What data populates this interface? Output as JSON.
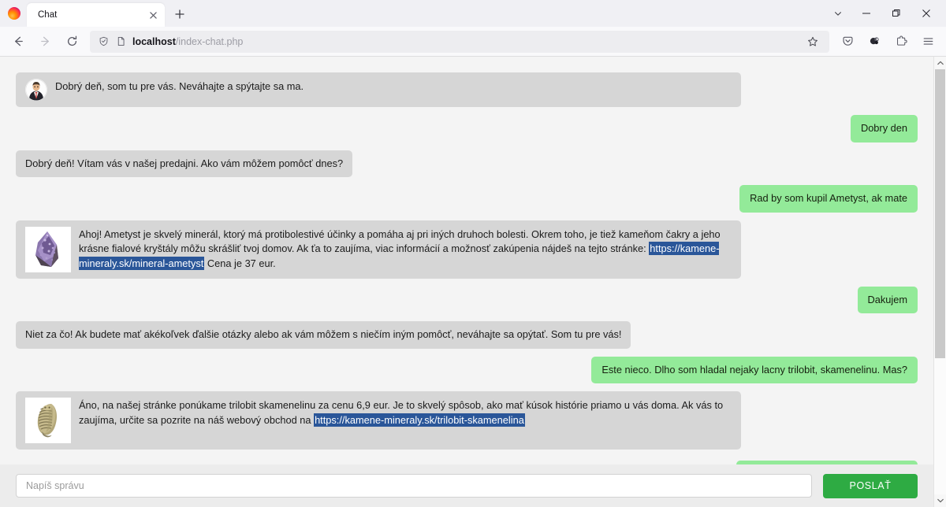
{
  "browser": {
    "tab": {
      "title": "Chat",
      "close_label": "×"
    },
    "newtab_label": "+",
    "tab_list_label": "List all tabs",
    "window": {
      "minimize": "—",
      "maximize": "▢",
      "close": "✕"
    },
    "nav": {
      "back": "back-arrow",
      "forward": "forward-arrow",
      "reload": "reload-arrow"
    },
    "url": {
      "host": "localhost",
      "path": "/index-chat.php",
      "full": "localhost/index-chat.php"
    },
    "toolbar_icons": [
      "shield-icon",
      "page-info-icon",
      "bookmark-star-icon",
      "pocket-save-icon",
      "firefox-account-icon",
      "extensions-icon",
      "app-menu-icon"
    ]
  },
  "chat": {
    "messages": [
      {
        "id": "m1",
        "side": "left",
        "kind": "avatar",
        "avatar": "agent-avatar",
        "text": "Dobrý deň, som tu pre vás. Neváhajte a spýtajte sa ma.",
        "width": "full"
      },
      {
        "id": "m2",
        "side": "right",
        "kind": "plain",
        "text": "Dobry den"
      },
      {
        "id": "m3",
        "side": "left",
        "kind": "plain",
        "text": "Dobrý deň! Vítam vás v našej predajni. Ako vám môžem pomôcť dnes?"
      },
      {
        "id": "m4",
        "side": "right",
        "kind": "plain",
        "text": "Rad by som kupil Ametyst, ak mate"
      },
      {
        "id": "m5",
        "side": "left",
        "kind": "image",
        "image": "amethyst-thumbnail",
        "width": "wide",
        "text_before": "Ahoj! Ametyst je skvelý minerál, ktorý má protibolestivé účinky a pomáha aj pri iných druhoch bolesti. Okrem toho, je tiež kameňom čakry a jeho krásne fialové kryštály môžu skrášliť tvoj domov. Ak ťa to zaujíma, viac informácií a možnosť zakúpenia nájdeš na tejto stránke: ",
        "selected_link": "https://kamene-mineraly.sk/mineral-ametyst",
        "text_after": " Cena je 37 eur."
      },
      {
        "id": "m6",
        "side": "right",
        "kind": "plain",
        "text": "Dakujem"
      },
      {
        "id": "m7",
        "side": "left",
        "kind": "plain",
        "text": "Niet za čo! Ak budete mať akékoľvek ďalšie otázky alebo ak vám môžem s niečím iným pomôcť, neváhajte sa opýtať. Som tu pre vás!"
      },
      {
        "id": "m8",
        "side": "right",
        "kind": "plain",
        "text": "Este nieco. Dlho som hladal nejaky lacny trilobit, skamenelinu. Mas?"
      },
      {
        "id": "m9",
        "side": "left",
        "kind": "image",
        "image": "trilobite-thumbnail",
        "width": "wide",
        "text_before": "Áno, na našej stránke ponúkame trilobit skamenelinu za cenu 6,9 eur. Je to skvelý spôsob, ako mať kúsok histórie priamo u vás doma. Ak vás to zaujíma, určite sa pozrite na náš webový obchod na ",
        "selected_link": "https://kamene-mineraly.sk/trilobit-skamenelina",
        "text_after": ""
      }
    ],
    "clipped_message_note": "partially visible user bubble below"
  },
  "composer": {
    "input_value": "",
    "input_placeholder": "Napíš správu",
    "send_label": "POSLAŤ"
  },
  "colors": {
    "user_bubble": "#93ea99",
    "bot_bubble": "#d6d6d6",
    "send_button": "#2eab43",
    "selection": "#2a5699",
    "chat_background": "#f4f4f4",
    "composer_background": "#ececec"
  },
  "scrollbar": {
    "up_label": "scroll-up",
    "down_label": "scroll-down",
    "thumb_position_percent": 0
  }
}
